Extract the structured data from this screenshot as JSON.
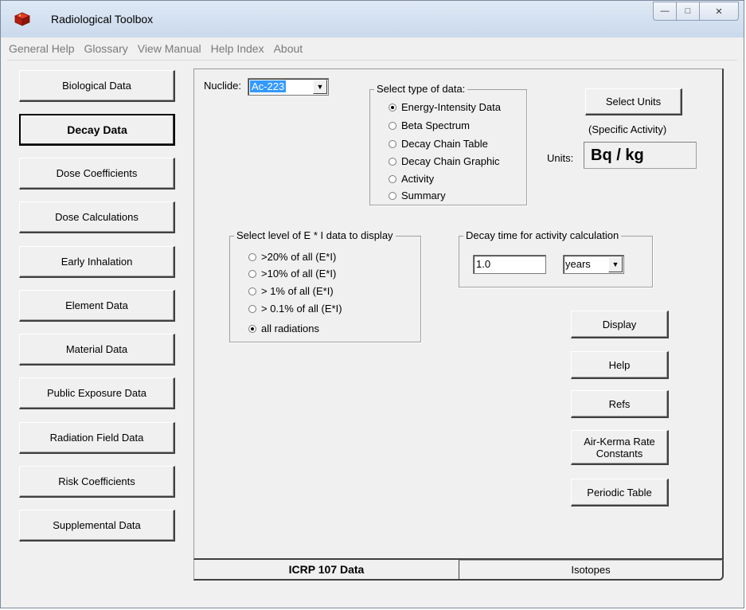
{
  "window": {
    "title": "Radiological Toolbox",
    "controls": {
      "minimize": "—",
      "maximize": "□",
      "close": "✕"
    }
  },
  "menu": [
    "General Help",
    "Glossary",
    "View Manual",
    "Help Index",
    "About"
  ],
  "sidebar": [
    {
      "label": "Biological Data",
      "active": false
    },
    {
      "label": "Decay Data",
      "active": true
    },
    {
      "label": "Dose Coefficients",
      "active": false
    },
    {
      "label": "Dose Calculations",
      "active": false
    },
    {
      "label": "Early Inhalation",
      "active": false
    },
    {
      "label": "Element Data",
      "active": false
    },
    {
      "label": "Material Data",
      "active": false
    },
    {
      "label": "Public Exposure Data",
      "active": false
    },
    {
      "label": "Radiation Field Data",
      "active": false
    },
    {
      "label": "Risk Coefficients",
      "active": false
    },
    {
      "label": "Supplemental Data",
      "active": false
    }
  ],
  "nuclide": {
    "label": "Nuclide:",
    "value": "Ac-223"
  },
  "data_type": {
    "title": "Select type of data:",
    "options": [
      "Energy-Intensity Data",
      "Beta Spectrum",
      "Decay Chain Table",
      "Decay Chain Graphic",
      "Activity",
      "Summary"
    ],
    "selected_index": 0
  },
  "units": {
    "select_button": "Select Units",
    "caption": "(Specific Activity)",
    "label": "Units:",
    "value": "Bq / kg"
  },
  "ei_level": {
    "title": "Select level of E * I data to display",
    "options": [
      ">20% of all (E*I)",
      ">10% of all (E*I)",
      "> 1% of all (E*I)",
      "> 0.1% of all (E*I)",
      "all radiations"
    ],
    "selected_index": 4
  },
  "decay_time": {
    "title": "Decay time for activity calculation",
    "value": "1.0",
    "unit": "years"
  },
  "actions": {
    "display": "Display",
    "help": "Help",
    "refs": "Refs",
    "air_kerma": "Air-Kerma Rate Constants",
    "periodic_table": "Periodic Table"
  },
  "tabs": [
    {
      "label": "ICRP 107 Data",
      "active": true
    },
    {
      "label": "Isotopes",
      "active": false
    }
  ],
  "dropdown_arrow": "▼"
}
